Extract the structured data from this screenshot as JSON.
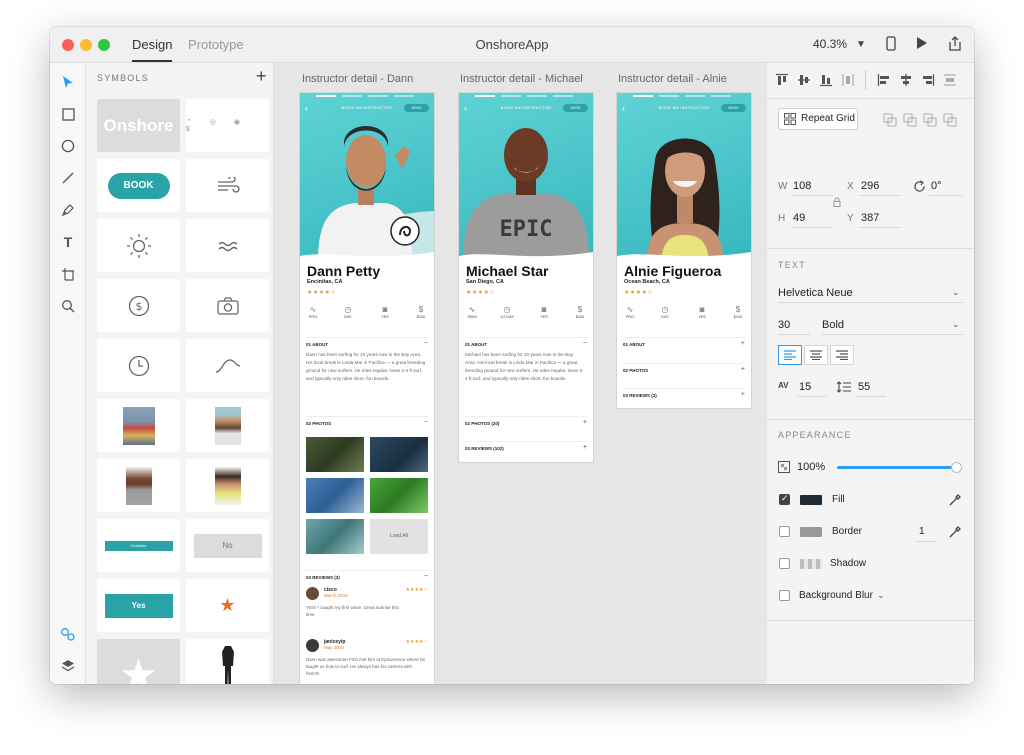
{
  "titlebar": {
    "tab_design": "Design",
    "tab_prototype": "Prototype",
    "app_title": "OnshoreApp",
    "zoom": "40.3%"
  },
  "symbols": {
    "title": "SYMBOLS",
    "add": "+",
    "logo_text": "Onshore",
    "book_label": "BOOK",
    "no_label": "No",
    "yes_label": "Yes",
    "continue_label": "Continue"
  },
  "artboards": [
    {
      "label": "Instructor detail - Dann",
      "hero_top": "BOOK AN INSTRUCTOR",
      "book": "BOOK",
      "name": "Dann Petty",
      "location": "Encinitas, CA",
      "stars": "★★★★☆",
      "stats": [
        "PRO",
        "DAY",
        "YES",
        "$100"
      ],
      "about_title": "01 ABOUT",
      "about_text": "Dann has been surfing for 10 years now in the Bay Area. His local break is Linda Mar in Pacifica — a great breeding ground for new surfers. He rides regular, loves 2-4 ft surf, and typically only rides short, fun boards.",
      "photos_title": "02 PHOTOS",
      "load_all": "Load All",
      "reviews_title": "03 REVIEWS (3)",
      "reviews": [
        {
          "name": "cisco",
          "date": "March 2016",
          "stars": "★★★★☆",
          "text": "YES! I caught my first wave. Great sunrise this time."
        },
        {
          "name": "janiceyip",
          "date": "May 2016",
          "stars": "★★★★☆",
          "text": "Dann was awesome! First met him at Epicurrence where he taught us how to surf. He always has his camera with him!!!!!"
        }
      ]
    },
    {
      "label": "Instructor detail - Michael",
      "hero_top": "BOOK AN INSTRUCTOR",
      "book": "BOOK",
      "name": "Michael Star",
      "location": "San Diego, CA",
      "stars": "★★★★☆",
      "stats": [
        "SEMI",
        "1/2 DAY",
        "YES",
        "$150"
      ],
      "about_title": "01 ABOUT",
      "about_text": "Michael has been surfing for 10 years now in the Bay Area. His local break is Linda Mar in Pacifica — a great breeding ground for new surfers. He rides regular, loves 2-4 ft surf, and typically only rides short, fun boards.",
      "photos_title": "02 PHOTOS (20)",
      "reviews_title": "03 REVIEWS (102)"
    },
    {
      "label": "Instructor detail - Alnie",
      "hero_top": "BOOK AN INSTRUCTOR",
      "book": "BOOK",
      "name": "Alnie Figueroa",
      "location": "Ocean Beach, CA",
      "stars": "★★★★☆",
      "stats": [
        "PRO",
        "DAY",
        "YES",
        "$100"
      ],
      "about_title": "01 ABOUT",
      "photos_title": "02 PHOTOS",
      "reviews_title": "03 REVIEWS (3)"
    }
  ],
  "inspector": {
    "repeat_grid": "Repeat Grid",
    "w_label": "W",
    "w_value": "108",
    "x_label": "X",
    "x_value": "296",
    "rotation": "0°",
    "h_label": "H",
    "h_value": "49",
    "y_label": "Y",
    "y_value": "387",
    "text_head": "TEXT",
    "font": "Helvetica Neue",
    "size": "30",
    "weight": "Bold",
    "spacing": "15",
    "line_height": "55",
    "appearance_head": "APPEARANCE",
    "opacity": "100%",
    "opacity_fraction": 1.0,
    "fill": "Fill",
    "border": "Border",
    "border_width": "1",
    "shadow": "Shadow",
    "background_blur": "Background Blur"
  },
  "colors": {
    "accent": "#2aa3a8",
    "star": "#e89a2a",
    "selection": "#2f9cf0",
    "fill_swatch": "#1f2a33"
  }
}
